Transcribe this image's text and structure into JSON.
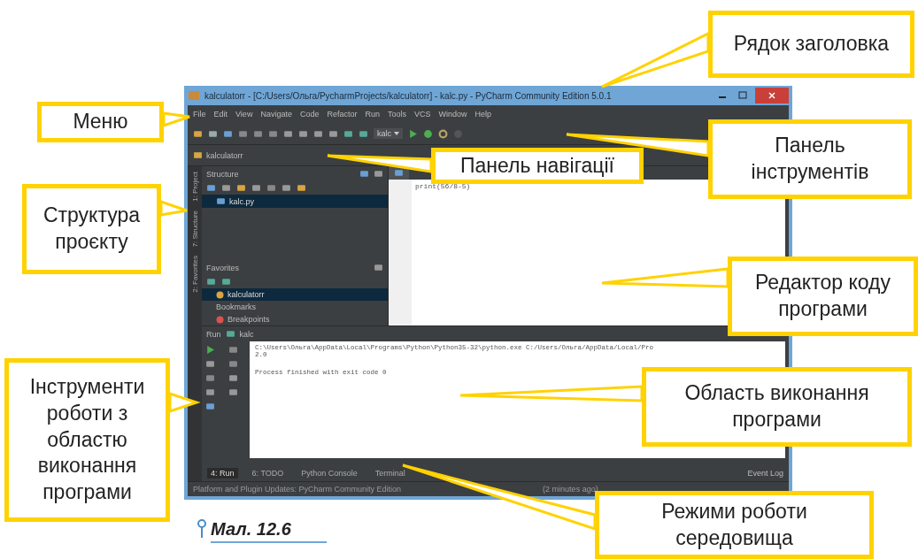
{
  "window": {
    "title": "kalculatorr - [C:/Users/Ольга/PycharmProjects/kalculatorr] - kalc.py - PyCharm Community Edition 5.0.1"
  },
  "menu": [
    "File",
    "Edit",
    "View",
    "Navigate",
    "Code",
    "Refactor",
    "Run",
    "Tools",
    "VCS",
    "Window",
    "Help"
  ],
  "toolbar": {
    "run_config": "kalc"
  },
  "navigation_bar": {
    "path": "kalculatorr"
  },
  "side_tabs": [
    {
      "label": "1: Project"
    },
    {
      "label": "7: Structure"
    },
    {
      "label": "2: Favorites"
    }
  ],
  "project_panel": {
    "title": "Structure",
    "items": [
      {
        "label": "kalc.py",
        "selected": true
      }
    ]
  },
  "favorites_panel": {
    "title": "Favorites",
    "items": [
      {
        "label": "kalculatorr",
        "selected": true,
        "kind": "project"
      },
      {
        "label": "Bookmarks",
        "selected": false,
        "kind": "plain"
      },
      {
        "label": "Breakpoints",
        "selected": false,
        "kind": "breakpoint"
      }
    ]
  },
  "editor": {
    "lines": [
      "print(56/8-5)"
    ]
  },
  "run_panel": {
    "title": "Run",
    "config": "kalc",
    "output": [
      "C:\\Users\\Ольга\\AppData\\Local\\Programs\\Python\\Python35-32\\python.exe C:/Users/Ольга/AppData/Local/Pro",
      "2.0"
    ],
    "exit_message": "Process finished with exit code 0"
  },
  "tool_windows": [
    {
      "label": "4: Run",
      "selected": true
    },
    {
      "label": "6: TODO",
      "selected": false
    },
    {
      "label": "Python Console",
      "selected": false
    },
    {
      "label": "Terminal",
      "selected": false
    }
  ],
  "event_log": "Event Log",
  "status_bar": {
    "message": "Platform and Plugin Updates: PyCharm Community Edition",
    "tail": "(2 minutes ago)"
  },
  "callouts": [
    {
      "text": "Рядок заголовка"
    },
    {
      "text": "Меню"
    },
    {
      "text": "Панель навігації"
    },
    {
      "text": "Панель інструментів"
    },
    {
      "text": "Структура проєкту"
    },
    {
      "text": "Редактор коду програми"
    },
    {
      "text": "Інструменти роботи з областю виконання програми"
    },
    {
      "text": "Область виконання програми"
    },
    {
      "text": "Режими роботи середовища"
    }
  ],
  "caption": "Мал. 12.6"
}
